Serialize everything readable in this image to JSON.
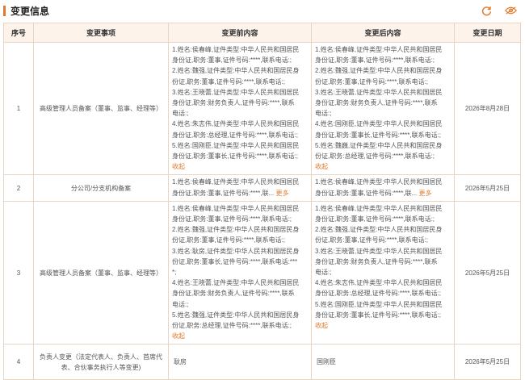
{
  "section": {
    "title": "变更信息"
  },
  "headers": [
    "序号",
    "变更事项",
    "变更前内容",
    "变更后内容",
    "变更日期"
  ],
  "rows": [
    {
      "index": "1",
      "type": "高级管理人员备案（董事、监事、经理等）",
      "before": [
        "1.姓名:侯春峰,证件类型:中华人民共和国居民",
        "身份证,职务:董事,证件号码:****,联系电话:;",
        "2.姓名:魏强,证件类型:中华人民共和国居民身",
        "份证,职务:董事,证件号码:****,联系电话:;",
        "3.姓名:王晓蕾,证件类型:中华人民共和国居民",
        "身份证,职务:财务负责人,证件号码:****,联系",
        "电话:;",
        "4.姓名:朱志伟,证件类型:中华人民共和国居民",
        "身份证,职务:总经理,证件号码:****,联系电话:;",
        "5.姓名:国刚臣,证件类型:中华人民共和国居民",
        "身份证,职务:董事长,证件号码:****,联系电话:;"
      ],
      "before_toggle": "收起",
      "after": [
        "1.姓名:侯春峰,证件类型:中华人民共和国居民",
        "身份证,职务:董事,证件号码:****,联系电话:;",
        "2.姓名:魏强,证件类型:中华人民共和国居民身",
        "份证,职务:董事,证件号码:****,联系电话:;",
        "3.姓名:王晓蕾,证件类型:中华人民共和国居民",
        "身份证,职务:财务负责人,证件号码:****,联系",
        "电话:;",
        "4.姓名:国刚臣,证件类型:中华人民共和国居民",
        "身份证,职务:董事长,证件号码:****,联系电话:;",
        "5.姓名:魏巍,证件类型:中华人民共和国居民身",
        "份证,职务:总经理,证件号码:****,联系电话:;"
      ],
      "after_toggle": "收起",
      "date": "2026年8月28日"
    },
    {
      "index": "2",
      "type": "分公司/分支机构备案",
      "before": [
        "1.姓名:侯春峰,证件类型:中华人民共和国居民",
        "身份证,职务:董事,证件号码:****,联..."
      ],
      "before_toggle": "更多",
      "after": [
        "1.姓名:侯春峰,证件类型:中华人民共和国居民",
        "身份证,职务:董事,证件号码:****,联..."
      ],
      "after_toggle": "更多",
      "date": "2026年5月25日"
    },
    {
      "index": "3",
      "type": "高级管理人员备案（董事、监事、经理等）",
      "before": [
        "1.姓名:侯春峰,证件类型:中华人民共和国居民",
        "身份证,职务:董事,证件号码:****,联系电话:;",
        "2.姓名:魏强,证件类型:中华人民共和国居民身",
        "份证,职务:董事,证件号码:****,联系电话:;",
        "3.姓名:耿房,证件类型:中华人民共和国居民身",
        "份证,职务:董事长,证件号码:****,联系电话:***",
        "*;",
        "4.姓名:王晓蕾,证件类型:中华人民共和国居民",
        "身份证,职务:财务负责人,证件号码:****,联系",
        "电话:;",
        "5.姓名:魏强,证件类型:中华人民共和国居民身",
        "份证,职务:总经理,证件号码:****,联系电话:;"
      ],
      "before_toggle": "收起",
      "after": [
        "1.姓名:侯春峰,证件类型:中华人民共和国居民",
        "身份证,职务:董事,证件号码:****,联系电话:;",
        "2.姓名:魏强,证件类型:中华人民共和国居民身",
        "份证,职务:董事,证件号码:****,联系电话:;",
        "3.姓名:王晓蕾,证件类型:中华人民共和国居民",
        "身份证,职务:财务负责人,证件号码:****,联系",
        "电话:;",
        "4.姓名:朱志伟,证件类型:中华人民共和国居民",
        "身份证,职务:总经理,证件号码:****,联系电话:;",
        "5.姓名:国刚臣,证件类型:中华人民共和国居民",
        "身份证,职务:董事长,证件号码:****,联系电话:;"
      ],
      "after_toggle": "收起",
      "date": "2026年5月25日"
    },
    {
      "index": "4",
      "type_lines": [
        "负责人变更（法定代表人、负责人、首席代",
        "表、合伙事务执行人等变更)"
      ],
      "before_plain": "耿房",
      "after_plain": "国刚臣",
      "date": "2026年5月25日"
    }
  ],
  "icons": {
    "refresh": "refresh-icon",
    "visibility": "eye-icon"
  },
  "colors": {
    "accent": "#e07a2a",
    "header_bg": "#fdf3ea",
    "border": "#e8d6c4"
  }
}
